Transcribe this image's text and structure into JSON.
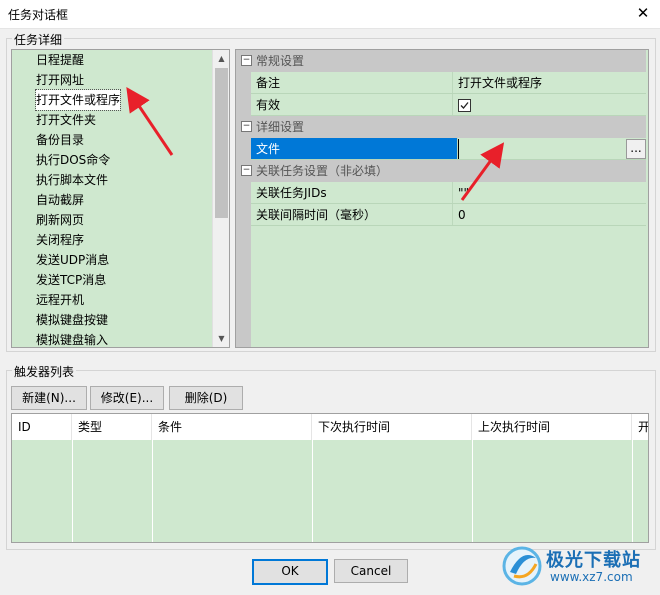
{
  "window": {
    "title": "任务对话框",
    "close_glyph": "✕"
  },
  "task_detail": {
    "group_label": "任务详细",
    "task_types": [
      "日程提醒",
      "打开网址",
      "打开文件或程序",
      "打开文件夹",
      "备份目录",
      "执行DOS命令",
      "执行脚本文件",
      "自动截屏",
      "刷新网页",
      "关闭程序",
      "发送UDP消息",
      "发送TCP消息",
      "远程开机",
      "模拟键盘按键",
      "模拟键盘输入"
    ],
    "selected_index": 2
  },
  "properties": {
    "categories": [
      {
        "label": "常规设置",
        "rows": [
          {
            "name": "备注",
            "value": "打开文件或程序"
          },
          {
            "name": "有效",
            "value": "",
            "checked": true
          }
        ]
      },
      {
        "label": "详细设置",
        "rows": [
          {
            "name": "文件",
            "value": "",
            "selected": true
          }
        ]
      },
      {
        "label": "关联任务设置（非必填）",
        "rows": [
          {
            "name": "关联任务JIDs",
            "value": "\"\""
          },
          {
            "name": "关联间隔时间（毫秒）",
            "value": "0"
          }
        ]
      }
    ],
    "collapse_glyph": "⊟",
    "browse_label": "..."
  },
  "triggers": {
    "group_label": "触发器列表",
    "buttons": {
      "new": "新建(N)...",
      "edit": "修改(E)...",
      "delete": "删除(D)"
    },
    "columns": [
      "ID",
      "类型",
      "条件",
      "下次执行时间",
      "上次执行时间",
      "开"
    ]
  },
  "footer": {
    "ok": "OK",
    "cancel": "Cancel"
  },
  "watermark": {
    "name": "极光下载站",
    "url": "www.xz7.com"
  },
  "colors": {
    "panel_green": "#cfe8cf",
    "selection_blue": "#0078d7",
    "arrow_red": "#e8202a"
  }
}
